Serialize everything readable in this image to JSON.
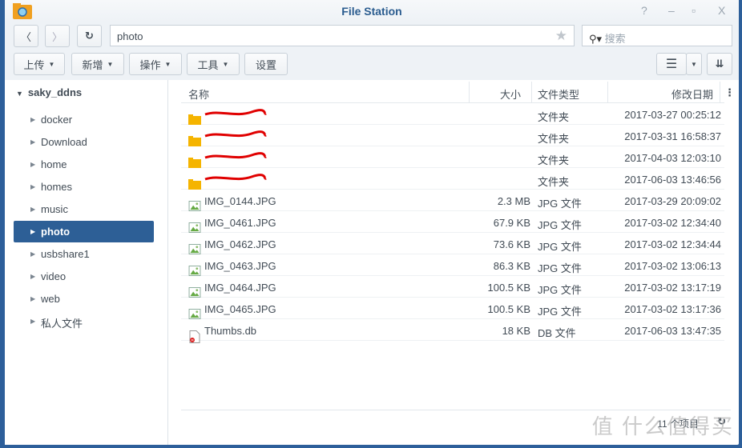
{
  "window": {
    "title": "File Station",
    "help": "?",
    "minimize": "–",
    "maximize": "▫",
    "close": "X"
  },
  "toolbar": {
    "path": "photo",
    "search_placeholder": "搜索",
    "upload": "上传",
    "create": "新增",
    "action": "操作",
    "tools": "工具",
    "settings": "设置"
  },
  "sidebar": {
    "root": "saky_ddns",
    "items": [
      {
        "label": "docker"
      },
      {
        "label": "Download"
      },
      {
        "label": "home"
      },
      {
        "label": "homes"
      },
      {
        "label": "music"
      },
      {
        "label": "photo",
        "selected": true
      },
      {
        "label": "usbshare1"
      },
      {
        "label": "video"
      },
      {
        "label": "web"
      },
      {
        "label": "私人文件"
      }
    ]
  },
  "table": {
    "headers": {
      "name": "名称",
      "size": "大小",
      "type": "文件类型",
      "date": "修改日期"
    },
    "rows": [
      {
        "name": "",
        "size": "",
        "type": "文件夹",
        "date": "2017-03-27 00:25:12",
        "icon": "folder-icon",
        "redacted": true
      },
      {
        "name": "",
        "size": "",
        "type": "文件夹",
        "date": "2017-03-31 16:58:37",
        "icon": "folder-icon",
        "redacted": true
      },
      {
        "name": "",
        "size": "",
        "type": "文件夹",
        "date": "2017-04-03 12:03:10",
        "icon": "folder-icon",
        "redacted": true
      },
      {
        "name": "",
        "size": "",
        "type": "文件夹",
        "date": "2017-06-03 13:46:56",
        "icon": "folder-icon",
        "redacted": true
      },
      {
        "name": "IMG_0144.JPG",
        "size": "2.3 MB",
        "type": "JPG 文件",
        "date": "2017-03-29 20:09:02",
        "icon": "image-icon"
      },
      {
        "name": "IMG_0461.JPG",
        "size": "67.9 KB",
        "type": "JPG 文件",
        "date": "2017-03-02 12:34:40",
        "icon": "image-icon"
      },
      {
        "name": "IMG_0462.JPG",
        "size": "73.6 KB",
        "type": "JPG 文件",
        "date": "2017-03-02 12:34:44",
        "icon": "image-icon"
      },
      {
        "name": "IMG_0463.JPG",
        "size": "86.3 KB",
        "type": "JPG 文件",
        "date": "2017-03-02 13:06:13",
        "icon": "image-icon"
      },
      {
        "name": "IMG_0464.JPG",
        "size": "100.5 KB",
        "type": "JPG 文件",
        "date": "2017-03-02 13:17:19",
        "icon": "image-icon"
      },
      {
        "name": "IMG_0465.JPG",
        "size": "100.5 KB",
        "type": "JPG 文件",
        "date": "2017-03-02 13:17:36",
        "icon": "image-icon"
      },
      {
        "name": "Thumbs.db",
        "size": "18 KB",
        "type": "DB 文件",
        "date": "2017-06-03 13:47:35",
        "icon": "db-file-icon"
      }
    ]
  },
  "footer": {
    "count": "11 个项目"
  },
  "watermark": "值 什么值得买",
  "colors": {
    "accent": "#2d5f96",
    "folder": "#f5b400",
    "redaction": "#e00000"
  }
}
